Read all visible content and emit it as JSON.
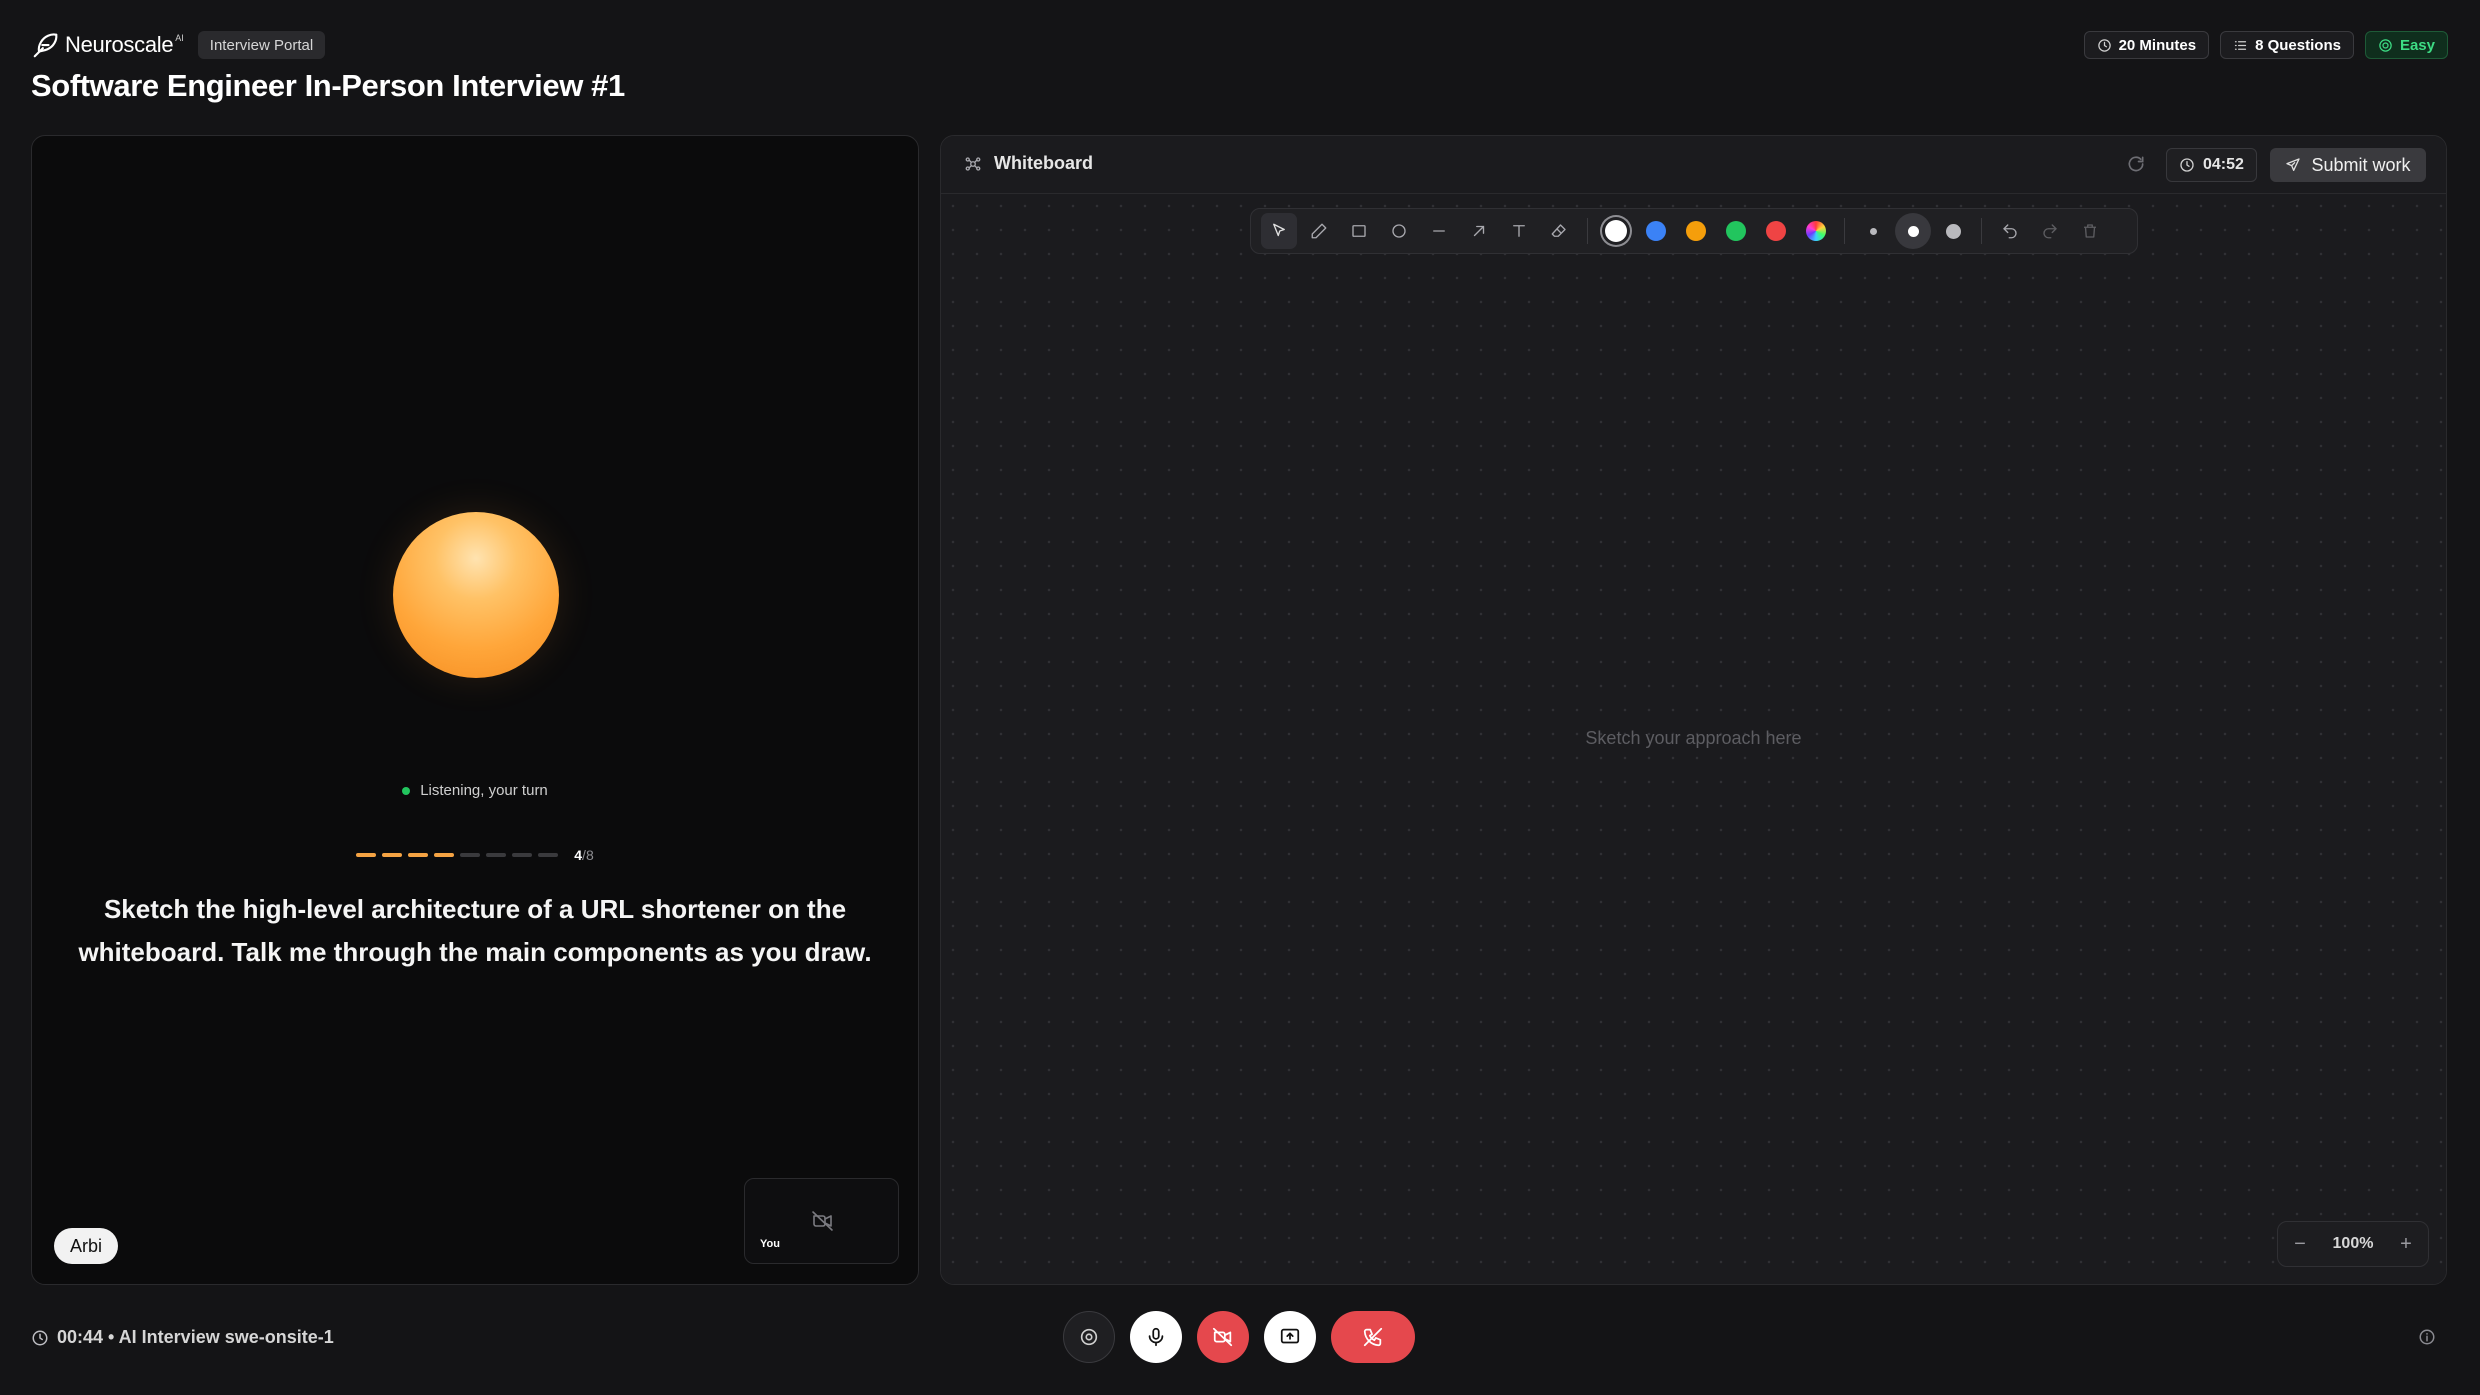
{
  "brand": {
    "name": "Neuroscale",
    "superscript": "AI",
    "portal_badge": "Interview Portal"
  },
  "page_title": "Software Engineer In-Person Interview #1",
  "meta": {
    "duration": "20 Minutes",
    "questions": "8 Questions",
    "difficulty": "Easy"
  },
  "interviewer": {
    "status": "Listening, your turn",
    "progress": {
      "current": "4",
      "total": "8",
      "separator": "/"
    },
    "question": "Sketch the high-level architecture of a URL shortener on the whiteboard. Talk me through the main components as you draw.",
    "name": "Arbi",
    "self_label": "You"
  },
  "whiteboard": {
    "title": "Whiteboard",
    "timer": "04:52",
    "submit_label": "Submit work",
    "canvas_hint": "Sketch your approach here",
    "zoom": "100%",
    "zoom_out_label": "−",
    "zoom_in_label": "+",
    "colors": [
      "#ffffff",
      "#3b82f6",
      "#f59e0b",
      "#22c55e",
      "#ef4444"
    ]
  },
  "footer": {
    "status": "00:44 • AI Interview swe-onsite-1"
  },
  "theme": {
    "accent_orange": "#f5a343",
    "success_green": "#22c55e",
    "danger_red": "#e5484d"
  },
  "icons": [
    "feather-logo-icon",
    "clock-icon",
    "list-icon",
    "target-icon",
    "collaboration-icon",
    "refresh-icon",
    "send-icon",
    "cursor-icon",
    "pencil-icon",
    "rectangle-icon",
    "circle-icon",
    "line-icon",
    "arrow-icon",
    "text-icon",
    "eraser-icon",
    "undo-icon",
    "redo-icon",
    "trash-icon",
    "camera-off-icon",
    "settings-icon",
    "mic-icon",
    "screen-share-icon",
    "hang-up-icon",
    "info-icon"
  ]
}
